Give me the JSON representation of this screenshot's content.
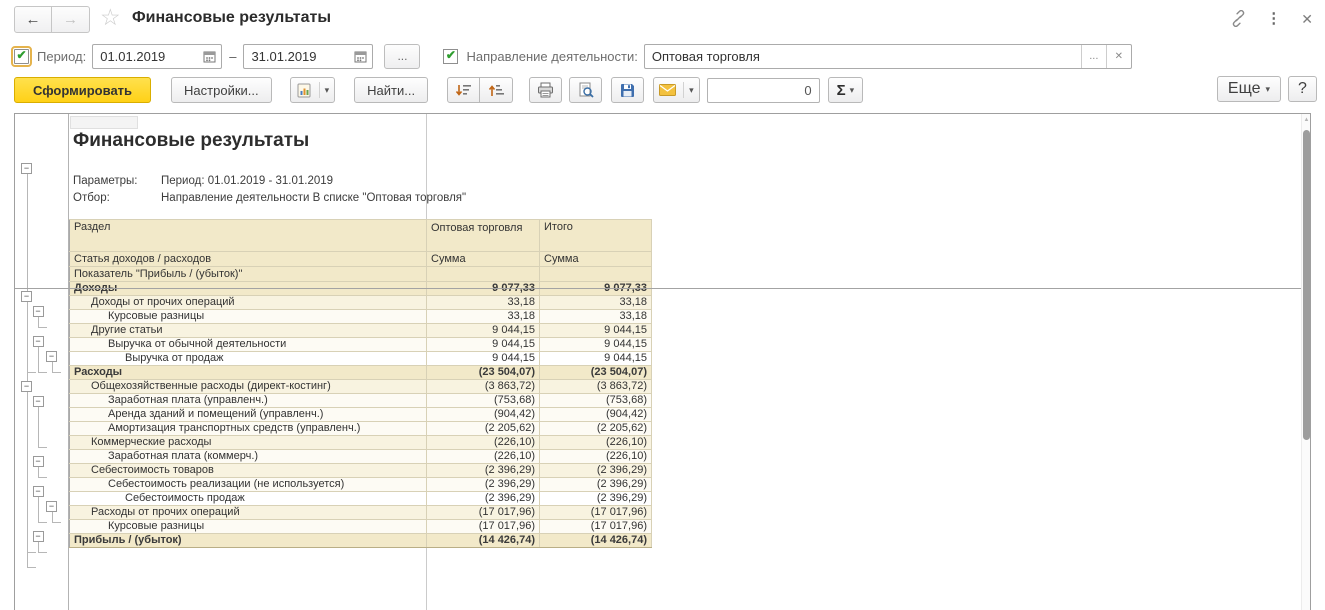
{
  "window": {
    "title": "Финансовые результаты"
  },
  "icons": {
    "back": "←",
    "forward": "→",
    "star": "☆",
    "more_vert": "⋮",
    "close": "✕",
    "check": "✔",
    "ellipsis": "...",
    "clear": "✕",
    "dropdown": "▾",
    "sigma": "Σ",
    "help": "?",
    "up_arrow": "▲",
    "collapse": "−",
    "dash": "–"
  },
  "filters": {
    "period": {
      "label": "Период:",
      "checked": true,
      "from": "01.01.2019",
      "to": "31.01.2019"
    },
    "direction": {
      "label": "Направление деятельности:",
      "checked": true,
      "value": "Оптовая торговля"
    }
  },
  "toolbar": {
    "generate": "Сформировать",
    "settings": "Настройки...",
    "find": "Найти...",
    "counter": "0",
    "more": "Еще",
    "help": "?"
  },
  "report": {
    "title": "Финансовые результаты",
    "params_label": "Параметры:",
    "params_value": "Период: 01.01.2019 - 31.01.2019",
    "filter_label": "Отбор:",
    "filter_value": "Направление деятельности В списке \"Оптовая торговля\"",
    "table": {
      "header": {
        "col1_row1": "Раздел",
        "col2_row1": "Оптовая торговля",
        "col3_row1": "Итого",
        "col1_row2": "Статья доходов / расходов",
        "col2_row2": "Сумма",
        "col3_row2": "Сумма",
        "col1_row3": "Показатель \"Прибыль / (убыток)\""
      },
      "rows": [
        {
          "label": "Доходы",
          "level": 0,
          "bold": true,
          "values": [
            "9 077,33",
            "9 077,33"
          ]
        },
        {
          "label": "Доходы от прочих операций",
          "level": 1,
          "bold": false,
          "values": [
            "33,18",
            "33,18"
          ]
        },
        {
          "label": "Курсовые разницы",
          "level": 2,
          "bold": false,
          "values": [
            "33,18",
            "33,18"
          ]
        },
        {
          "label": "Другие статьи",
          "level": 1,
          "bold": false,
          "values": [
            "9 044,15",
            "9 044,15"
          ]
        },
        {
          "label": "Выручка от обычной деятельности",
          "level": 2,
          "bold": false,
          "values": [
            "9 044,15",
            "9 044,15"
          ]
        },
        {
          "label": "Выручка от продаж",
          "level": 3,
          "bold": false,
          "values": [
            "9 044,15",
            "9 044,15"
          ]
        },
        {
          "label": "Расходы",
          "level": 0,
          "bold": true,
          "values": [
            "(23 504,07)",
            "(23 504,07)"
          ]
        },
        {
          "label": "Общехозяйственные расходы (директ-костинг)",
          "level": 1,
          "bold": false,
          "values": [
            "(3 863,72)",
            "(3 863,72)"
          ]
        },
        {
          "label": "Заработная плата (управленч.)",
          "level": 2,
          "bold": false,
          "values": [
            "(753,68)",
            "(753,68)"
          ]
        },
        {
          "label": "Аренда зданий и помещений (управленч.)",
          "level": 2,
          "bold": false,
          "values": [
            "(904,42)",
            "(904,42)"
          ]
        },
        {
          "label": "Амортизация транспортных средств (управленч.)",
          "level": 2,
          "bold": false,
          "values": [
            "(2 205,62)",
            "(2 205,62)"
          ]
        },
        {
          "label": "Коммерческие расходы",
          "level": 1,
          "bold": false,
          "values": [
            "(226,10)",
            "(226,10)"
          ]
        },
        {
          "label": "Заработная плата (коммерч.)",
          "level": 2,
          "bold": false,
          "values": [
            "(226,10)",
            "(226,10)"
          ]
        },
        {
          "label": "Себестоимость товаров",
          "level": 1,
          "bold": false,
          "values": [
            "(2 396,29)",
            "(2 396,29)"
          ]
        },
        {
          "label": "Себестоимость реализации (не используется)",
          "level": 2,
          "bold": false,
          "values": [
            "(2 396,29)",
            "(2 396,29)"
          ]
        },
        {
          "label": "Себестоимость продаж",
          "level": 3,
          "bold": false,
          "values": [
            "(2 396,29)",
            "(2 396,29)"
          ]
        },
        {
          "label": "Расходы от прочих операций",
          "level": 1,
          "bold": false,
          "values": [
            "(17 017,96)",
            "(17 017,96)"
          ]
        },
        {
          "label": "Курсовые разницы",
          "level": 2,
          "bold": false,
          "values": [
            "(17 017,96)",
            "(17 017,96)"
          ]
        },
        {
          "label": "Прибыль / (убыток)",
          "level": 0,
          "bold": true,
          "values": [
            "(14 426,74)",
            "(14 426,74)"
          ]
        }
      ]
    }
  },
  "colors": {
    "accent_yellow": "#ffd72b",
    "header_beige": "#f2e9c9",
    "group_beige": "#f8f3e0",
    "check_green": "#2f9e2f",
    "split_line": "#a3a3a3"
  }
}
